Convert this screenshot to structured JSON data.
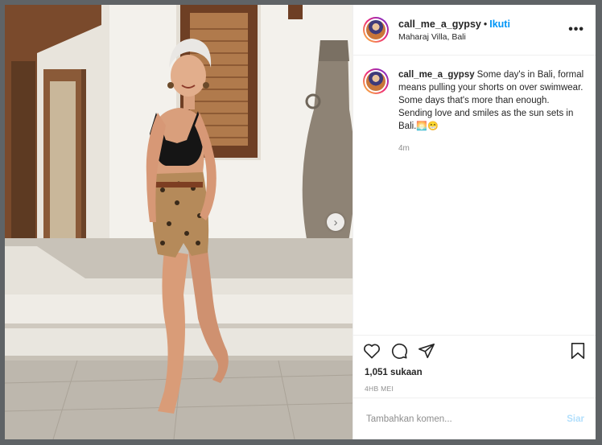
{
  "post": {
    "username": "call_me_a_gypsy",
    "separator": "•",
    "follow_label": "Ikuti",
    "location": "Maharaj Villa, Bali",
    "more_icon": "more-options-icon",
    "more_symbol": "•••",
    "next_symbol": "›"
  },
  "caption": {
    "username": "call_me_a_gypsy",
    "line1": "Some day's in Bali, formal means pulling your shorts on over swimwear.",
    "line2": "Some days that's more than enough. Sending love and smiles as the sun sets in Bali.",
    "emoji": "🌅😁",
    "time_ago": "4m"
  },
  "actions": {
    "icons": [
      "heart-icon",
      "comment-icon",
      "share-icon",
      "bookmark-icon"
    ]
  },
  "likes": "1,051 sukaan",
  "date": "4HB MEI",
  "comment": {
    "placeholder": "Tambahkan komen...",
    "post_label": "Siar"
  },
  "colors": {
    "accent": "#0095f6",
    "post_button_disabled": "#b2dffc",
    "backdrop": "#5f6366"
  }
}
